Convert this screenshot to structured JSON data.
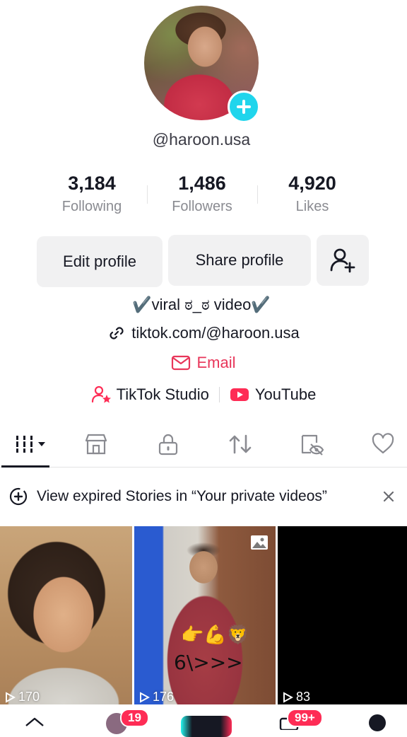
{
  "profile": {
    "username": "@haroon.usa",
    "stats": [
      {
        "value": "3,184",
        "label": "Following"
      },
      {
        "value": "1,486",
        "label": "Followers"
      },
      {
        "value": "4,920",
        "label": "Likes"
      }
    ],
    "buttons": {
      "edit": "Edit profile",
      "share": "Share profile"
    },
    "bio": "✔️viral ಠ_ಠ video✔️",
    "link": "tiktok.com/@haroon.usa",
    "email_label": "Email",
    "tiktok_studio_label": "TikTok Studio",
    "youtube_label": "YouTube"
  },
  "tabs": [
    {
      "icon": "grid-icon"
    },
    {
      "icon": "shop-icon"
    },
    {
      "icon": "lock-icon"
    },
    {
      "icon": "repost-icon"
    },
    {
      "icon": "tagged-eye-icon"
    },
    {
      "icon": "heart-icon"
    }
  ],
  "banner": {
    "text": "View expired Stories in “Your private videos”"
  },
  "videos": [
    {
      "views": "170"
    },
    {
      "views": "176",
      "overlay_text": "6\\>>>"
    },
    {
      "views": "83"
    }
  ],
  "nav": {
    "inbox_badge": "19",
    "messages_badge": "99+"
  },
  "colors": {
    "accent": "#fe2c55",
    "plus_badge": "#20d5ec",
    "email": "#e8365a"
  }
}
